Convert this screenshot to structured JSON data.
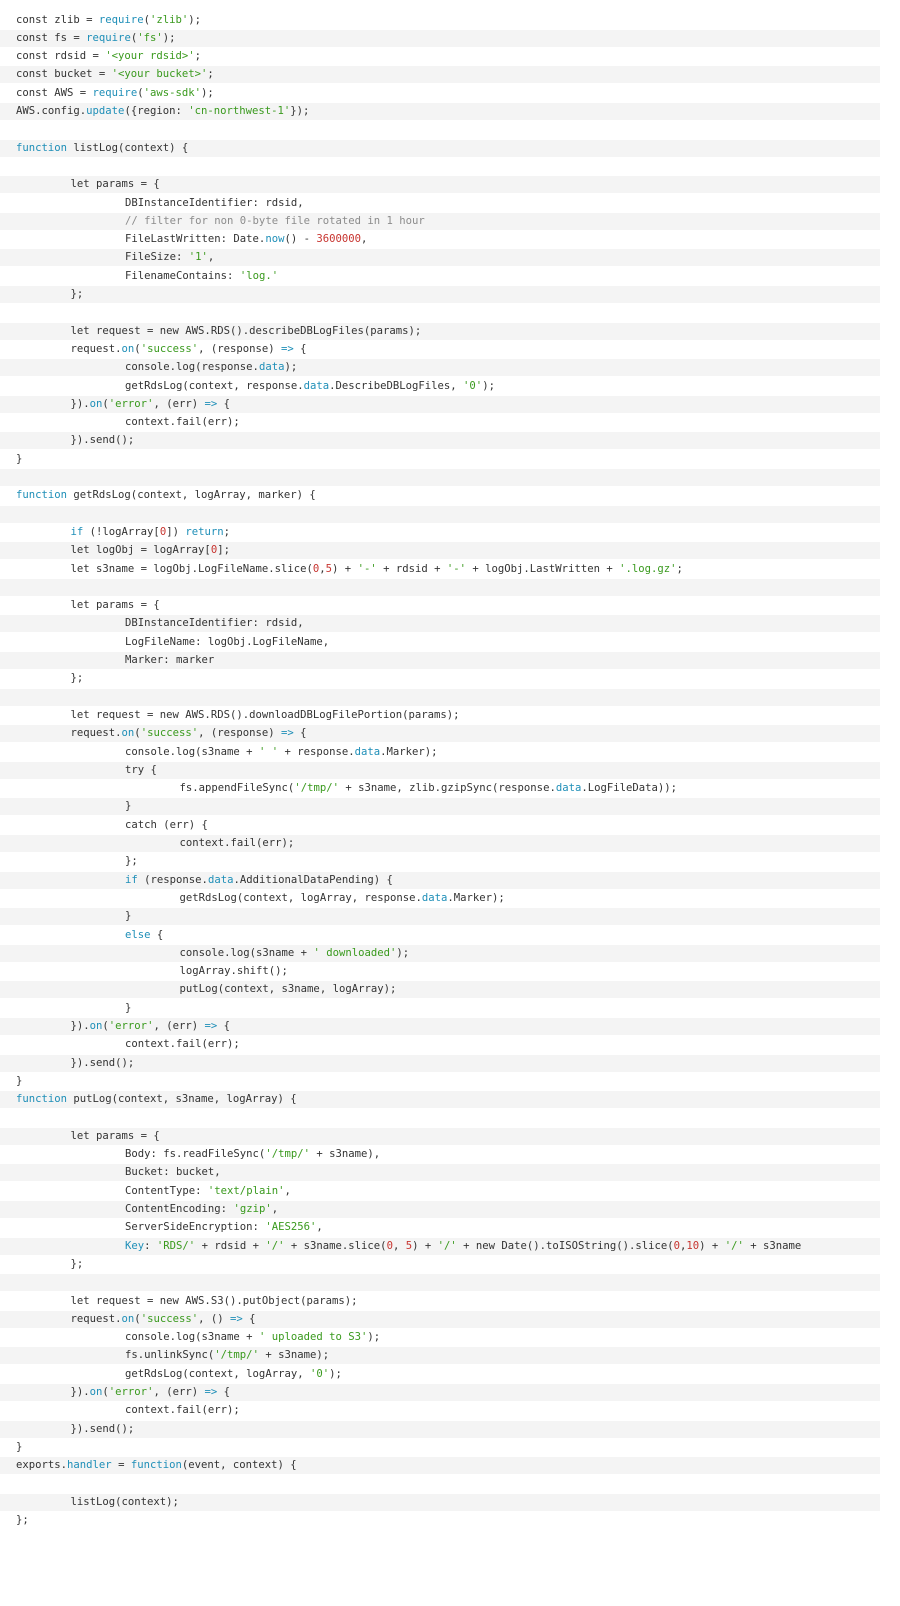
{
  "document": {
    "language": "javascript",
    "colors": {
      "background": "#ffffff",
      "alt_line_background": "#f4f4f4",
      "text": "#333333",
      "keyword": "#1f8fb8",
      "string": "#3a9a1e",
      "number": "#c7342f",
      "comment": "#8c8c8c"
    },
    "lines": [
      {
        "indent": 0,
        "tokens": [
          [
            "t",
            "const zlib = "
          ],
          [
            "k",
            "require"
          ],
          [
            "t",
            "("
          ],
          [
            "s",
            "'zlib'"
          ],
          [
            "t",
            ");"
          ]
        ]
      },
      {
        "indent": 0,
        "tokens": [
          [
            "t",
            "const fs = "
          ],
          [
            "k",
            "require"
          ],
          [
            "t",
            "("
          ],
          [
            "s",
            "'fs'"
          ],
          [
            "t",
            ");"
          ]
        ]
      },
      {
        "indent": 0,
        "tokens": [
          [
            "t",
            "const rdsid = "
          ],
          [
            "s",
            "'<your rdsid>'"
          ],
          [
            "t",
            ";"
          ]
        ]
      },
      {
        "indent": 0,
        "tokens": [
          [
            "t",
            "const bucket = "
          ],
          [
            "s",
            "'<your bucket>'"
          ],
          [
            "t",
            ";"
          ]
        ]
      },
      {
        "indent": 0,
        "tokens": [
          [
            "t",
            "const AWS = "
          ],
          [
            "k",
            "require"
          ],
          [
            "t",
            "("
          ],
          [
            "s",
            "'aws-sdk'"
          ],
          [
            "t",
            ");"
          ]
        ]
      },
      {
        "indent": 0,
        "tokens": [
          [
            "t",
            "AWS.config."
          ],
          [
            "k",
            "update"
          ],
          [
            "t",
            "({region: "
          ],
          [
            "s",
            "'cn-northwest-1'"
          ],
          [
            "t",
            "});"
          ]
        ]
      },
      {
        "indent": 0,
        "tokens": []
      },
      {
        "indent": 0,
        "tokens": [
          [
            "k",
            "function"
          ],
          [
            "t",
            " listLog(context) {"
          ]
        ]
      },
      {
        "indent": 0,
        "tokens": []
      },
      {
        "indent": 1,
        "tokens": [
          [
            "t",
            "let params = {"
          ]
        ]
      },
      {
        "indent": 2,
        "tokens": [
          [
            "t",
            "DBInstanceIdentifier: rdsid,"
          ]
        ]
      },
      {
        "indent": 2,
        "tokens": [
          [
            "c",
            "// filter for non 0-byte file rotated in 1 hour"
          ]
        ]
      },
      {
        "indent": 2,
        "tokens": [
          [
            "t",
            "FileLastWritten: Date."
          ],
          [
            "k",
            "now"
          ],
          [
            "t",
            "() - "
          ],
          [
            "n",
            "3600000"
          ],
          [
            "t",
            ","
          ]
        ]
      },
      {
        "indent": 2,
        "tokens": [
          [
            "t",
            "FileSize: "
          ],
          [
            "s",
            "'1'"
          ],
          [
            "t",
            ","
          ]
        ]
      },
      {
        "indent": 2,
        "tokens": [
          [
            "t",
            "FilenameContains: "
          ],
          [
            "s",
            "'log.'"
          ]
        ]
      },
      {
        "indent": 1,
        "tokens": [
          [
            "t",
            "};"
          ]
        ]
      },
      {
        "indent": 0,
        "tokens": []
      },
      {
        "indent": 1,
        "tokens": [
          [
            "t",
            "let request = new AWS.RDS().describeDBLogFiles(params);"
          ]
        ]
      },
      {
        "indent": 1,
        "tokens": [
          [
            "t",
            "request."
          ],
          [
            "k",
            "on"
          ],
          [
            "t",
            "("
          ],
          [
            "s",
            "'success'"
          ],
          [
            "t",
            ", (response) "
          ],
          [
            "k",
            "=>"
          ],
          [
            "t",
            " {"
          ]
        ]
      },
      {
        "indent": 2,
        "tokens": [
          [
            "t",
            "console.log(response."
          ],
          [
            "k",
            "data"
          ],
          [
            "t",
            ");"
          ]
        ]
      },
      {
        "indent": 2,
        "tokens": [
          [
            "t",
            "getRdsLog(context, response."
          ],
          [
            "k",
            "data"
          ],
          [
            "t",
            ".DescribeDBLogFiles, "
          ],
          [
            "s",
            "'0'"
          ],
          [
            "t",
            ");"
          ]
        ]
      },
      {
        "indent": 1,
        "tokens": [
          [
            "t",
            "})."
          ],
          [
            "k",
            "on"
          ],
          [
            "t",
            "("
          ],
          [
            "s",
            "'error'"
          ],
          [
            "t",
            ", (err) "
          ],
          [
            "k",
            "=>"
          ],
          [
            "t",
            " {"
          ]
        ]
      },
      {
        "indent": 2,
        "tokens": [
          [
            "t",
            "context.fail(err);"
          ]
        ]
      },
      {
        "indent": 1,
        "tokens": [
          [
            "t",
            "}).send();"
          ]
        ]
      },
      {
        "indent": 0,
        "tokens": [
          [
            "t",
            "}"
          ]
        ]
      },
      {
        "indent": 0,
        "tokens": []
      },
      {
        "indent": 0,
        "tokens": [
          [
            "k",
            "function"
          ],
          [
            "t",
            " getRdsLog(context, logArray, marker) {"
          ]
        ]
      },
      {
        "indent": 0,
        "tokens": []
      },
      {
        "indent": 1,
        "tokens": [
          [
            "k",
            "if"
          ],
          [
            "t",
            " (!logArray["
          ],
          [
            "n",
            "0"
          ],
          [
            "t",
            "]) "
          ],
          [
            "k",
            "return"
          ],
          [
            "t",
            ";"
          ]
        ]
      },
      {
        "indent": 1,
        "tokens": [
          [
            "t",
            "let logObj = logArray["
          ],
          [
            "n",
            "0"
          ],
          [
            "t",
            "];"
          ]
        ]
      },
      {
        "indent": 1,
        "tokens": [
          [
            "t",
            "let s3name = logObj.LogFileName.slice("
          ],
          [
            "n",
            "0"
          ],
          [
            "t",
            ","
          ],
          [
            "n",
            "5"
          ],
          [
            "t",
            ") + "
          ],
          [
            "s",
            "'-'"
          ],
          [
            "t",
            " + rdsid + "
          ],
          [
            "s",
            "'-'"
          ],
          [
            "t",
            " + logObj.LastWritten + "
          ],
          [
            "s",
            "'.log.gz'"
          ],
          [
            "t",
            ";"
          ]
        ]
      },
      {
        "indent": 0,
        "tokens": []
      },
      {
        "indent": 1,
        "tokens": [
          [
            "t",
            "let params = {"
          ]
        ]
      },
      {
        "indent": 2,
        "tokens": [
          [
            "t",
            "DBInstanceIdentifier: rdsid,"
          ]
        ]
      },
      {
        "indent": 2,
        "tokens": [
          [
            "t",
            "LogFileName: logObj.LogFileName,"
          ]
        ]
      },
      {
        "indent": 2,
        "tokens": [
          [
            "t",
            "Marker: marker"
          ]
        ]
      },
      {
        "indent": 1,
        "tokens": [
          [
            "t",
            "};"
          ]
        ]
      },
      {
        "indent": 0,
        "tokens": []
      },
      {
        "indent": 1,
        "tokens": [
          [
            "t",
            "let request = new AWS.RDS().downloadDBLogFilePortion(params);"
          ]
        ]
      },
      {
        "indent": 1,
        "tokens": [
          [
            "t",
            "request."
          ],
          [
            "k",
            "on"
          ],
          [
            "t",
            "("
          ],
          [
            "s",
            "'success'"
          ],
          [
            "t",
            ", (response) "
          ],
          [
            "k",
            "=>"
          ],
          [
            "t",
            " {"
          ]
        ]
      },
      {
        "indent": 2,
        "tokens": [
          [
            "t",
            "console.log(s3name + "
          ],
          [
            "s",
            "' '"
          ],
          [
            "t",
            " + response."
          ],
          [
            "k",
            "data"
          ],
          [
            "t",
            ".Marker);"
          ]
        ]
      },
      {
        "indent": 2,
        "tokens": [
          [
            "t",
            "try {"
          ]
        ]
      },
      {
        "indent": 3,
        "tokens": [
          [
            "t",
            "fs.appendFileSync("
          ],
          [
            "s",
            "'/tmp/'"
          ],
          [
            "t",
            " + s3name, zlib.gzipSync(response."
          ],
          [
            "k",
            "data"
          ],
          [
            "t",
            ".LogFileData));"
          ]
        ]
      },
      {
        "indent": 2,
        "tokens": [
          [
            "t",
            "}"
          ]
        ]
      },
      {
        "indent": 2,
        "tokens": [
          [
            "t",
            "catch (err) {"
          ]
        ]
      },
      {
        "indent": 3,
        "tokens": [
          [
            "t",
            "context.fail(err);"
          ]
        ]
      },
      {
        "indent": 2,
        "tokens": [
          [
            "t",
            "};"
          ]
        ]
      },
      {
        "indent": 2,
        "tokens": [
          [
            "k",
            "if"
          ],
          [
            "t",
            " (response."
          ],
          [
            "k",
            "data"
          ],
          [
            "t",
            ".AdditionalDataPending) {"
          ]
        ]
      },
      {
        "indent": 3,
        "tokens": [
          [
            "t",
            "getRdsLog(context, logArray, response."
          ],
          [
            "k",
            "data"
          ],
          [
            "t",
            ".Marker);"
          ]
        ]
      },
      {
        "indent": 2,
        "tokens": [
          [
            "t",
            "}"
          ]
        ]
      },
      {
        "indent": 2,
        "tokens": [
          [
            "k",
            "else"
          ],
          [
            "t",
            " {"
          ]
        ]
      },
      {
        "indent": 3,
        "tokens": [
          [
            "t",
            "console.log(s3name + "
          ],
          [
            "s",
            "' downloaded'"
          ],
          [
            "t",
            ");"
          ]
        ]
      },
      {
        "indent": 3,
        "tokens": [
          [
            "t",
            "logArray.shift();"
          ]
        ]
      },
      {
        "indent": 3,
        "tokens": [
          [
            "t",
            "putLog(context, s3name, logArray);"
          ]
        ]
      },
      {
        "indent": 2,
        "tokens": [
          [
            "t",
            "}"
          ]
        ]
      },
      {
        "indent": 1,
        "tokens": [
          [
            "t",
            "})."
          ],
          [
            "k",
            "on"
          ],
          [
            "t",
            "("
          ],
          [
            "s",
            "'error'"
          ],
          [
            "t",
            ", (err) "
          ],
          [
            "k",
            "=>"
          ],
          [
            "t",
            " {"
          ]
        ]
      },
      {
        "indent": 2,
        "tokens": [
          [
            "t",
            "context.fail(err);"
          ]
        ]
      },
      {
        "indent": 1,
        "tokens": [
          [
            "t",
            "}).send();"
          ]
        ]
      },
      {
        "indent": 0,
        "tokens": [
          [
            "t",
            "}"
          ]
        ]
      },
      {
        "indent": 0,
        "tokens": [
          [
            "k",
            "function"
          ],
          [
            "t",
            " putLog(context, s3name, logArray) {"
          ]
        ]
      },
      {
        "indent": 0,
        "tokens": []
      },
      {
        "indent": 1,
        "tokens": [
          [
            "t",
            "let params = {"
          ]
        ]
      },
      {
        "indent": 2,
        "tokens": [
          [
            "t",
            "Body: fs.readFileSync("
          ],
          [
            "s",
            "'/tmp/'"
          ],
          [
            "t",
            " + s3name),"
          ]
        ]
      },
      {
        "indent": 2,
        "tokens": [
          [
            "t",
            "Bucket: bucket,"
          ]
        ]
      },
      {
        "indent": 2,
        "tokens": [
          [
            "t",
            "ContentType: "
          ],
          [
            "s",
            "'text/plain'"
          ],
          [
            "t",
            ","
          ]
        ]
      },
      {
        "indent": 2,
        "tokens": [
          [
            "t",
            "ContentEncoding: "
          ],
          [
            "s",
            "'gzip'"
          ],
          [
            "t",
            ","
          ]
        ]
      },
      {
        "indent": 2,
        "tokens": [
          [
            "t",
            "ServerSideEncryption: "
          ],
          [
            "s",
            "'AES256'"
          ],
          [
            "t",
            ","
          ]
        ]
      },
      {
        "indent": 2,
        "tokens": [
          [
            "k",
            "Key"
          ],
          [
            "t",
            ": "
          ],
          [
            "s",
            "'RDS/'"
          ],
          [
            "t",
            " + rdsid + "
          ],
          [
            "s",
            "'/'"
          ],
          [
            "t",
            " + s3name.slice("
          ],
          [
            "n",
            "0"
          ],
          [
            "t",
            ", "
          ],
          [
            "n",
            "5"
          ],
          [
            "t",
            ") + "
          ],
          [
            "s",
            "'/'"
          ],
          [
            "t",
            " + new Date().toISOString().slice("
          ],
          [
            "n",
            "0"
          ],
          [
            "t",
            ","
          ],
          [
            "n",
            "10"
          ],
          [
            "t",
            ") + "
          ],
          [
            "s",
            "'/'"
          ],
          [
            "t",
            " + s3name"
          ]
        ]
      },
      {
        "indent": 1,
        "tokens": [
          [
            "t",
            "};"
          ]
        ]
      },
      {
        "indent": 0,
        "tokens": []
      },
      {
        "indent": 1,
        "tokens": [
          [
            "t",
            "let request = new AWS.S3().putObject(params);"
          ]
        ]
      },
      {
        "indent": 1,
        "tokens": [
          [
            "t",
            "request."
          ],
          [
            "k",
            "on"
          ],
          [
            "t",
            "("
          ],
          [
            "s",
            "'success'"
          ],
          [
            "t",
            ", () "
          ],
          [
            "k",
            "=>"
          ],
          [
            "t",
            " {"
          ]
        ]
      },
      {
        "indent": 2,
        "tokens": [
          [
            "t",
            "console.log(s3name + "
          ],
          [
            "s",
            "' uploaded to S3'"
          ],
          [
            "t",
            ");"
          ]
        ]
      },
      {
        "indent": 2,
        "tokens": [
          [
            "t",
            "fs.unlinkSync("
          ],
          [
            "s",
            "'/tmp/'"
          ],
          [
            "t",
            " + s3name);"
          ]
        ]
      },
      {
        "indent": 2,
        "tokens": [
          [
            "t",
            "getRdsLog(context, logArray, "
          ],
          [
            "s",
            "'0'"
          ],
          [
            "t",
            ");"
          ]
        ]
      },
      {
        "indent": 1,
        "tokens": [
          [
            "t",
            "})."
          ],
          [
            "k",
            "on"
          ],
          [
            "t",
            "("
          ],
          [
            "s",
            "'error'"
          ],
          [
            "t",
            ", (err) "
          ],
          [
            "k",
            "=>"
          ],
          [
            "t",
            " {"
          ]
        ]
      },
      {
        "indent": 2,
        "tokens": [
          [
            "t",
            "context.fail(err);"
          ]
        ]
      },
      {
        "indent": 1,
        "tokens": [
          [
            "t",
            "}).send();"
          ]
        ]
      },
      {
        "indent": 0,
        "tokens": [
          [
            "t",
            "}"
          ]
        ]
      },
      {
        "indent": 0,
        "tokens": [
          [
            "t",
            "exports."
          ],
          [
            "k",
            "handler"
          ],
          [
            "t",
            " = "
          ],
          [
            "k",
            "function"
          ],
          [
            "t",
            "(event, context) {"
          ]
        ]
      },
      {
        "indent": 0,
        "tokens": []
      },
      {
        "indent": 1,
        "tokens": [
          [
            "t",
            "listLog(context);"
          ]
        ]
      },
      {
        "indent": 0,
        "tokens": [
          [
            "t",
            "};"
          ]
        ]
      }
    ]
  }
}
